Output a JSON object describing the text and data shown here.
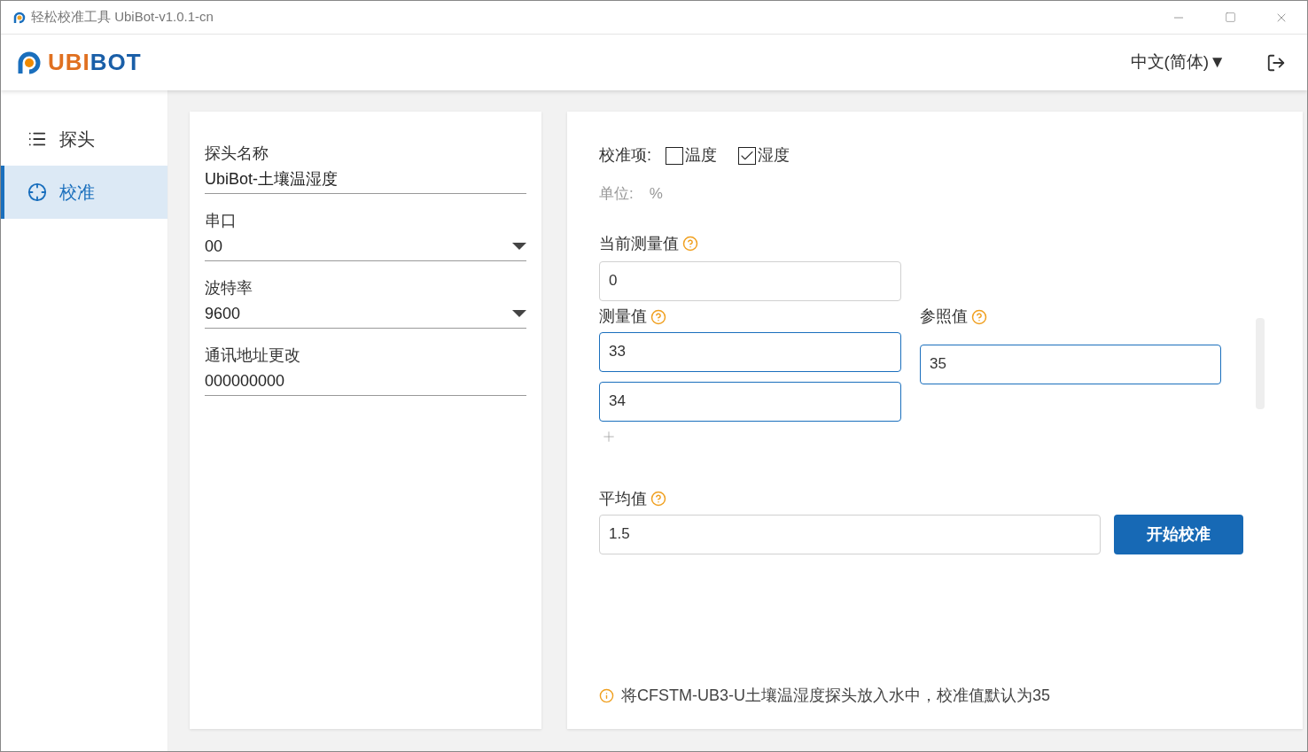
{
  "window": {
    "title": "轻松校准工具 UbiBot-v1.0.1-cn"
  },
  "header": {
    "logo": {
      "part_1": "UBI",
      "part_2": "BOT"
    },
    "language": "中文(简体)▼"
  },
  "sidebar": {
    "items": [
      {
        "label": "探头",
        "kind": "list",
        "selected": false
      },
      {
        "label": "校准",
        "kind": "target",
        "selected": true
      }
    ]
  },
  "probe_panel": {
    "fields": [
      {
        "label": "探头名称",
        "value": "UbiBot-土壤温湿度",
        "kind": "text"
      },
      {
        "label": "串口",
        "value": "00",
        "kind": "select"
      },
      {
        "label": "波特率",
        "value": "9600",
        "kind": "select"
      },
      {
        "label": "通讯地址更改",
        "value": "000000000",
        "kind": "text"
      }
    ]
  },
  "calibration_panel": {
    "items_label": "校准项:",
    "items": [
      {
        "label": "温度",
        "checked": false
      },
      {
        "label": "湿度",
        "checked": true
      }
    ],
    "unit_label": "单位:",
    "unit": "%",
    "current_label": "当前测量值",
    "current_value": "0",
    "measured_label": "测量值",
    "measured_values": [
      "33",
      "34"
    ],
    "reference_label": "参照值",
    "reference_value": "35",
    "average_label": "平均值",
    "average_value": "1.5",
    "start_button": "开始校准",
    "note": "将CFSTM-UB3-U土壤温湿度探头放入水中，校准值默认为35"
  }
}
